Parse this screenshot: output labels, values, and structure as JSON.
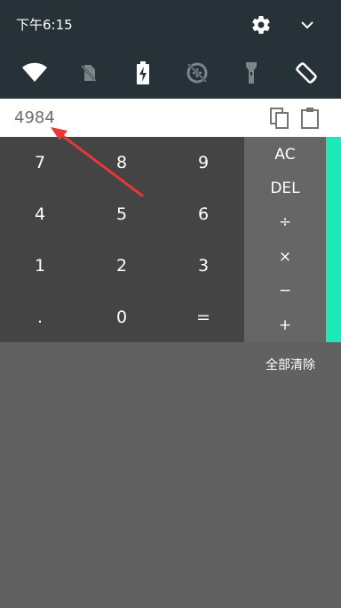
{
  "status_bar": {
    "time": "下午6:15",
    "icons": [
      "gear-icon",
      "chevron-down-icon"
    ]
  },
  "quick_tiles": [
    {
      "name": "wifi-icon",
      "active": true
    },
    {
      "name": "no-sim-icon",
      "active": false
    },
    {
      "name": "battery-charging-icon",
      "active": true
    },
    {
      "name": "data-saver-off-icon",
      "active": false
    },
    {
      "name": "flashlight-icon",
      "active": false
    },
    {
      "name": "auto-rotate-icon",
      "active": true
    }
  ],
  "calculator": {
    "display": "4984",
    "copy_icon": "copy-icon",
    "paste_icon": "clipboard-icon",
    "keys": [
      [
        "7",
        "8",
        "9"
      ],
      [
        "4",
        "5",
        "6"
      ],
      [
        "1",
        "2",
        "3"
      ],
      [
        ".",
        "0",
        "="
      ]
    ],
    "ops": [
      "AC",
      "DEL",
      "÷",
      "×",
      "−",
      "+"
    ],
    "clear_all": "全部清除"
  },
  "colors": {
    "shade": "#263238",
    "numpad": "#444444",
    "ops": "#666666",
    "accent": "#1de9b6",
    "background": "#616161",
    "arrow": "#e53935"
  }
}
